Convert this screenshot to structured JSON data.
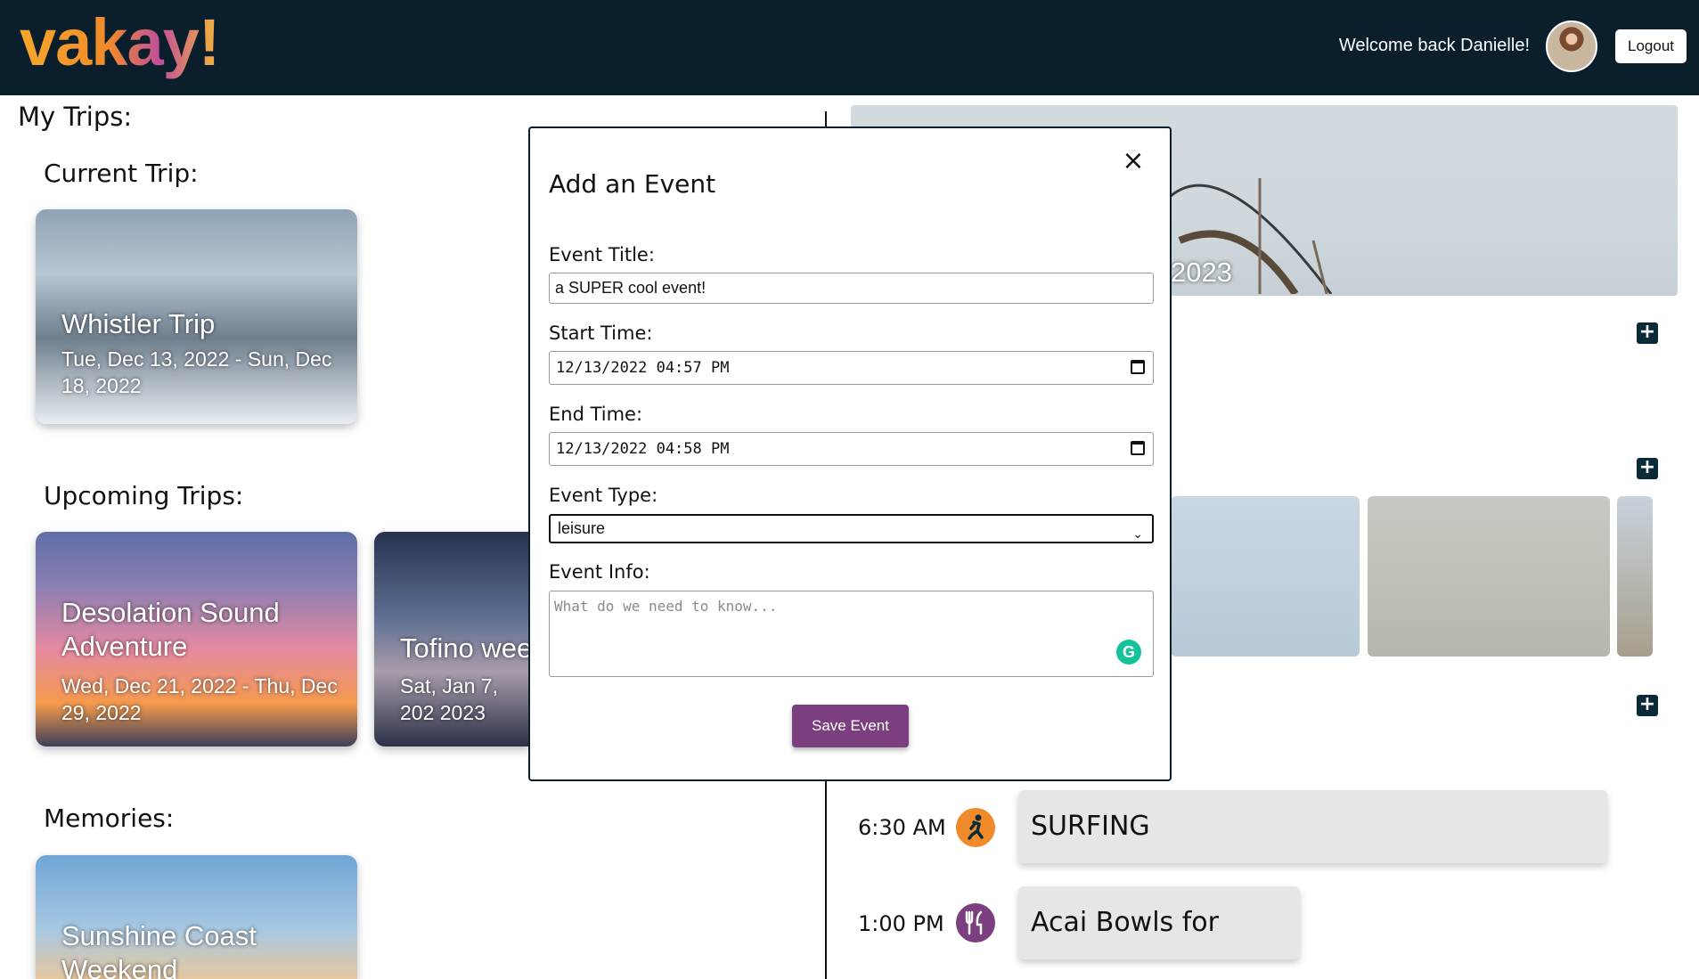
{
  "header": {
    "logo_text": "vakay!",
    "welcome_text": "Welcome back Danielle!",
    "logout_label": "Logout"
  },
  "left": {
    "my_trips_heading": "My Trips:",
    "current_heading": "Current Trip:",
    "upcoming_heading": "Upcoming Trips:",
    "memories_heading": "Memories:",
    "current_trip": {
      "title": "Whistler Trip",
      "dates": "Tue, Dec 13, 2022 - Sun, Dec 18, 2022"
    },
    "upcoming_trips": [
      {
        "title": "Desolation Sound Adventure",
        "dates": "Wed, Dec 21, 2022 - Thu, Dec 29, 2022"
      },
      {
        "title": "Tofino wee",
        "dates": "Sat, Jan 7, 202 2023"
      }
    ],
    "memories": [
      {
        "title": "Sunshine Coast Weekend"
      }
    ]
  },
  "right": {
    "banner_year": "2023",
    "events": [
      {
        "time": "6:30 AM",
        "title": "SURFING",
        "icon": "person-running-icon",
        "icon_color": "#f08a2b"
      },
      {
        "time": "1:00 PM",
        "title": "Acai Bowls for lunch!",
        "icon": "fork-knife-icon",
        "icon_color": "#7b3f7f"
      }
    ]
  },
  "modal": {
    "title": "Add an Event",
    "close_glyph": "×",
    "event_title_label": "Event Title:",
    "event_title_value": "a SUPER cool event!",
    "start_time_label": "Start Time:",
    "start_time_value": "12/13/2022 04:57 PM",
    "end_time_label": "End Time:",
    "end_time_value": "12/13/2022 04:58 PM",
    "event_type_label": "Event Type:",
    "event_type_value": "leisure",
    "event_info_label": "Event Info:",
    "event_info_placeholder": "What do we need to know...",
    "grammarly_glyph": "G",
    "save_label": "Save Event"
  },
  "colors": {
    "header_bg": "#0a1e2b",
    "save_button": "#7b3f7f",
    "plus_button": "#0a2a3a"
  }
}
